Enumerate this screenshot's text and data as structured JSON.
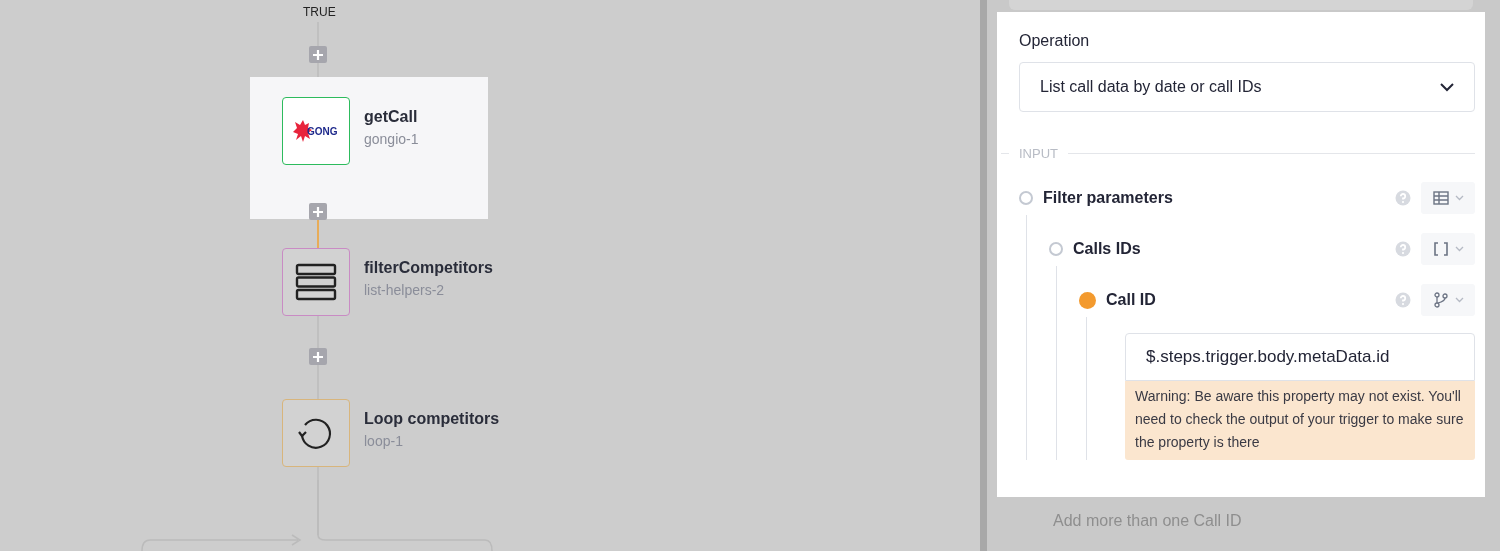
{
  "canvas": {
    "branch_label": "TRUE",
    "steps": [
      {
        "title": "getCall",
        "subtitle": "gongio-1",
        "kind": "gong",
        "logo_text": "GONG",
        "selected": true,
        "color": "#2dbb5d"
      },
      {
        "title": "filterCompetitors",
        "subtitle": "list-helpers-2",
        "kind": "list",
        "selected": false,
        "color": "#c98bc4"
      },
      {
        "title": "Loop competitors",
        "subtitle": "loop-1",
        "kind": "loop",
        "selected": false,
        "color": "#d8b57c"
      }
    ]
  },
  "panel": {
    "operation": {
      "label": "Operation",
      "value": "List call data by date or call IDs"
    },
    "section": "INPUT",
    "params": [
      {
        "label": "Filter parameters",
        "kind": "object",
        "filled": false,
        "children": [
          {
            "label": "Calls IDs",
            "kind": "array",
            "filled": false,
            "children": [
              {
                "label": "Call ID",
                "kind": "string",
                "filled": true,
                "value": "$.steps.trigger.body.metaData.id",
                "warning": "Warning: Be aware this property may not exist. You'll need to check the output of your trigger to make sure the property is there"
              }
            ]
          }
        ]
      }
    ],
    "footer_hint": "Add more than one Call ID"
  }
}
